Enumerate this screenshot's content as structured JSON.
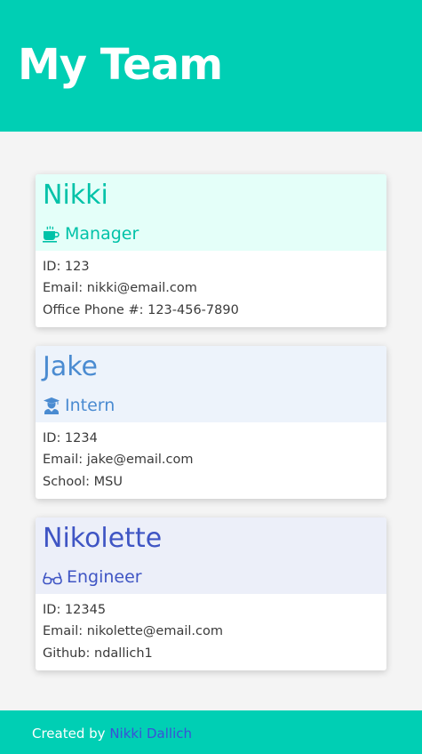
{
  "header": {
    "title": "My Team"
  },
  "team": [
    {
      "name": "Nikki",
      "role": "Manager",
      "icon": "coffee-icon",
      "accent": "#00c2a8",
      "head_bg": "#e4fff9",
      "lines": [
        "ID: 123",
        "Email: nikki@email.com",
        "Office Phone #: 123-456-7890"
      ]
    },
    {
      "name": "Jake",
      "role": "Intern",
      "icon": "graduate-icon",
      "accent": "#4a8bd1",
      "head_bg": "#edf3fb",
      "lines": [
        "ID: 1234",
        "Email: jake@email.com",
        "School: MSU"
      ]
    },
    {
      "name": "Nikolette",
      "role": "Engineer",
      "icon": "glasses-icon",
      "accent": "#3f55c4",
      "head_bg": "#eceff9",
      "lines": [
        "ID: 12345",
        "Email: nikolette@email.com",
        "Github: ndallich1"
      ]
    }
  ],
  "footer": {
    "prefix": "Created by ",
    "author_link": "Nikki Dallich"
  }
}
